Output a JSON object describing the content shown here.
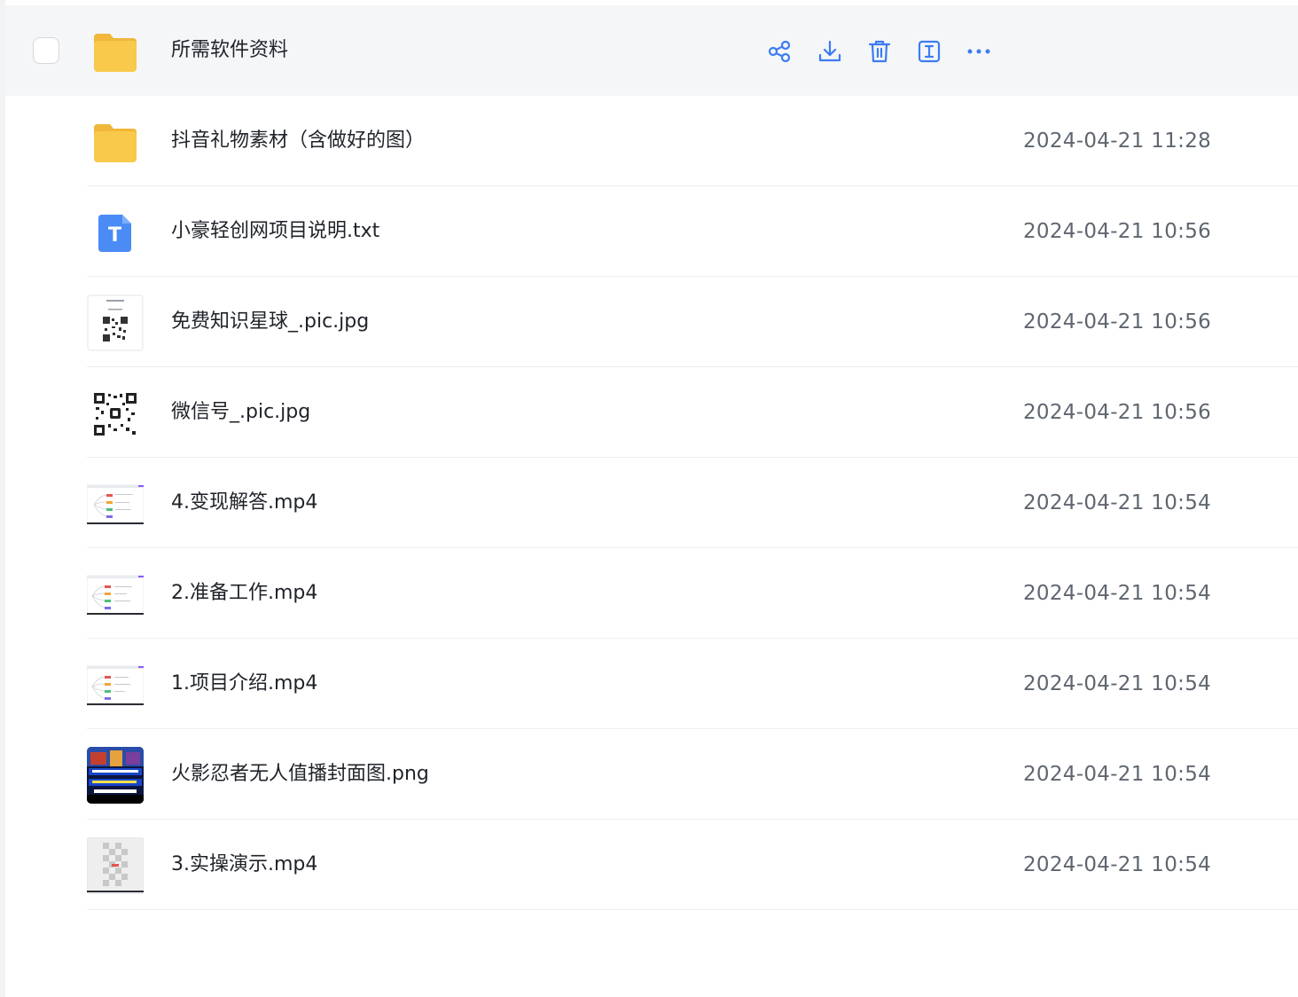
{
  "accent_color": "#3c7cf2",
  "folder_color": "#f8c94a",
  "files": [
    {
      "name": "所需软件资料",
      "date": "",
      "type": "folder",
      "icon": "folder-icon",
      "hovered": true
    },
    {
      "name": "抖音礼物素材（含做好的图）",
      "date": "2024-04-21 11:28",
      "type": "folder",
      "icon": "folder-icon"
    },
    {
      "name": "小豪轻创网项目说明.txt",
      "date": "2024-04-21 10:56",
      "type": "txt",
      "icon": "text-file-icon"
    },
    {
      "name": "免费知识星球_.pic.jpg",
      "date": "2024-04-21 10:56",
      "type": "image",
      "icon": "qr-thumbnail"
    },
    {
      "name": "微信号_.pic.jpg",
      "date": "2024-04-21 10:56",
      "type": "image",
      "icon": "qr-thumbnail"
    },
    {
      "name": "4.变现解答.mp4",
      "date": "2024-04-21 10:54",
      "type": "video",
      "icon": "mindmap-video-thumbnail"
    },
    {
      "name": "2.准备工作.mp4",
      "date": "2024-04-21 10:54",
      "type": "video",
      "icon": "mindmap-video-thumbnail"
    },
    {
      "name": "1.项目介绍.mp4",
      "date": "2024-04-21 10:54",
      "type": "video",
      "icon": "mindmap-video-thumbnail"
    },
    {
      "name": "火影忍者无人值播封面图.png",
      "date": "2024-04-21 10:54",
      "type": "image",
      "icon": "cover-image-thumbnail"
    },
    {
      "name": "3.实操演示.mp4",
      "date": "2024-04-21 10:54",
      "type": "video",
      "icon": "checker-video-thumbnail"
    }
  ],
  "row_actions": [
    "share-icon",
    "download-icon",
    "delete-icon",
    "rename-icon",
    "more-icon"
  ],
  "txt_icon_letter": "T"
}
